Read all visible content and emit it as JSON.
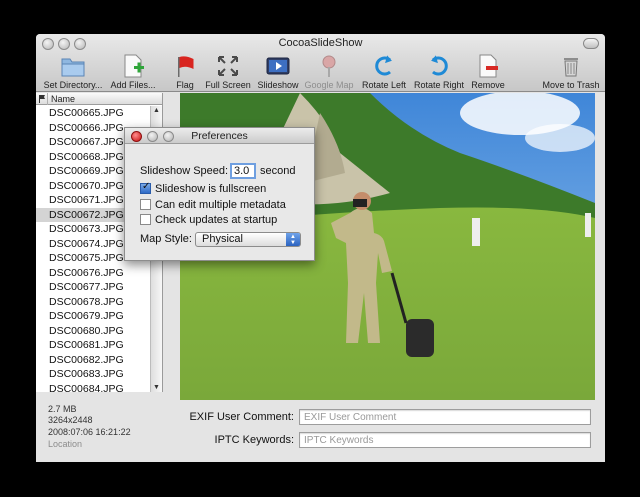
{
  "window": {
    "title": "CocoaSlideShow"
  },
  "toolbar": {
    "items": [
      {
        "label": "Set Directory...",
        "icon": "folder-icon"
      },
      {
        "label": "Add Files...",
        "icon": "add-file-icon"
      },
      {
        "label": "Flag",
        "icon": "flag-icon"
      },
      {
        "label": "Full Screen",
        "icon": "full-screen-icon"
      },
      {
        "label": "Slideshow",
        "icon": "slideshow-icon"
      },
      {
        "label": "Google Map",
        "icon": "map-pin-icon",
        "disabled": true
      },
      {
        "label": "Rotate Left",
        "icon": "rotate-left-icon"
      },
      {
        "label": "Rotate Right",
        "icon": "rotate-right-icon"
      },
      {
        "label": "Remove",
        "icon": "remove-icon"
      },
      {
        "label": "Move to Trash",
        "icon": "trash-icon"
      }
    ]
  },
  "file_list": {
    "header": {
      "name": "Name"
    },
    "selected": "DSC00672.JPG",
    "files": [
      "DSC00665.JPG",
      "DSC00666.JPG",
      "DSC00667.JPG",
      "DSC00668.JPG",
      "DSC00669.JPG",
      "DSC00670.JPG",
      "DSC00671.JPG",
      "DSC00672.JPG",
      "DSC00673.JPG",
      "DSC00674.JPG",
      "DSC00675.JPG",
      "DSC00676.JPG",
      "DSC00677.JPG",
      "DSC00678.JPG",
      "DSC00679.JPG",
      "DSC00680.JPG",
      "DSC00681.JPG",
      "DSC00682.JPG",
      "DSC00683.JPG",
      "DSC00684.JPG"
    ]
  },
  "file_info": {
    "size": "2.7 MB",
    "dimensions": "3264x2448",
    "date": "2008:07:06 16:21:22",
    "location": "Location"
  },
  "metadata": {
    "exif_label": "EXIF User Comment:",
    "exif_placeholder": "EXIF User Comment",
    "iptc_label": "IPTC Keywords:",
    "iptc_placeholder": "IPTC Keywords"
  },
  "preferences": {
    "title": "Preferences",
    "speed_label": "Slideshow Speed:",
    "speed_value": "3.0",
    "speed_unit": "second",
    "options": [
      {
        "label": "Slideshow is fullscreen",
        "checked": true
      },
      {
        "label": "Can edit multiple metadata",
        "checked": false
      },
      {
        "label": "Check updates at startup",
        "checked": false
      }
    ],
    "map_style_label": "Map Style:",
    "map_style_value": "Physical"
  },
  "colors": {
    "selection": "#d4d4d4",
    "checkbox_on": "#2f6bc7",
    "close_button": "#c60d0d"
  }
}
